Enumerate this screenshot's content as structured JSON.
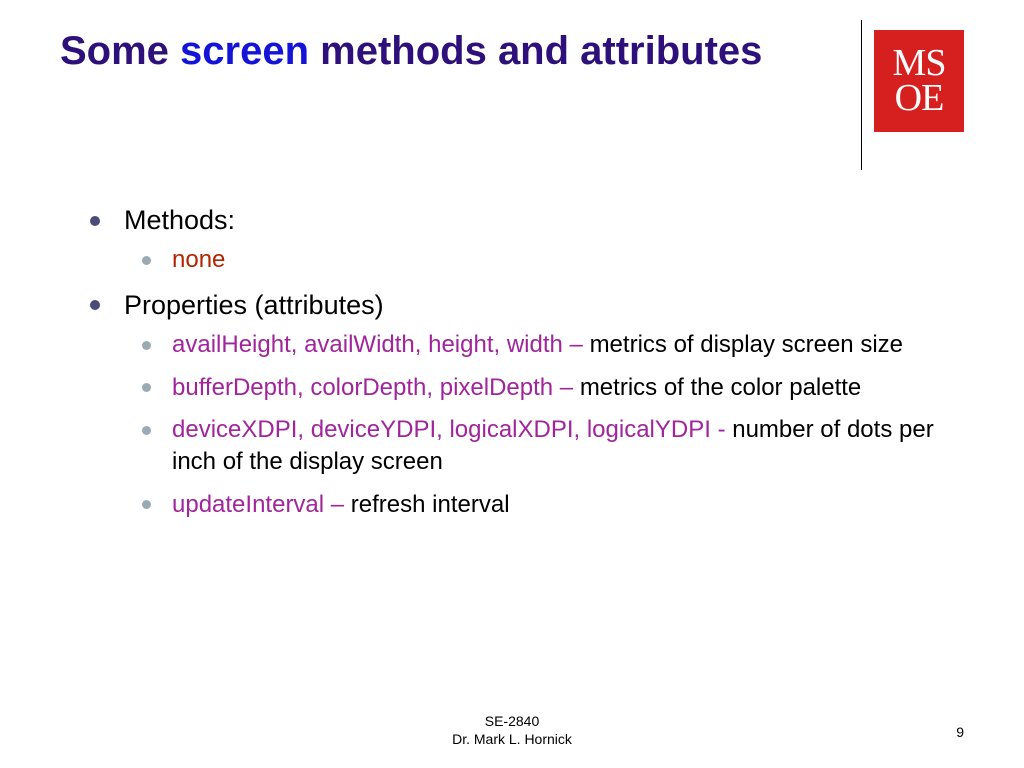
{
  "title": {
    "part1": "Some ",
    "highlight": "screen",
    "part2": " methods and attributes"
  },
  "logo": {
    "line1": "MS",
    "line2": "OE"
  },
  "bullets": {
    "methods_label": "Methods:",
    "methods_none": "none",
    "properties_label": "Properties (attributes)",
    "props": [
      {
        "code": "availHeight, availWidth, height, width – ",
        "desc": "metrics of display screen size"
      },
      {
        "code": "bufferDepth, colorDepth, pixelDepth – ",
        "desc": "metrics of the color palette"
      },
      {
        "code": "deviceXDPI, deviceYDPI, logicalXDPI, logicalYDPI - ",
        "desc": "number of dots per inch of the display screen"
      },
      {
        "code": "updateInterval – ",
        "desc": "refresh interval"
      }
    ]
  },
  "footer": {
    "course": "SE-2840",
    "author": "Dr. Mark L. Hornick"
  },
  "page_number": "9"
}
